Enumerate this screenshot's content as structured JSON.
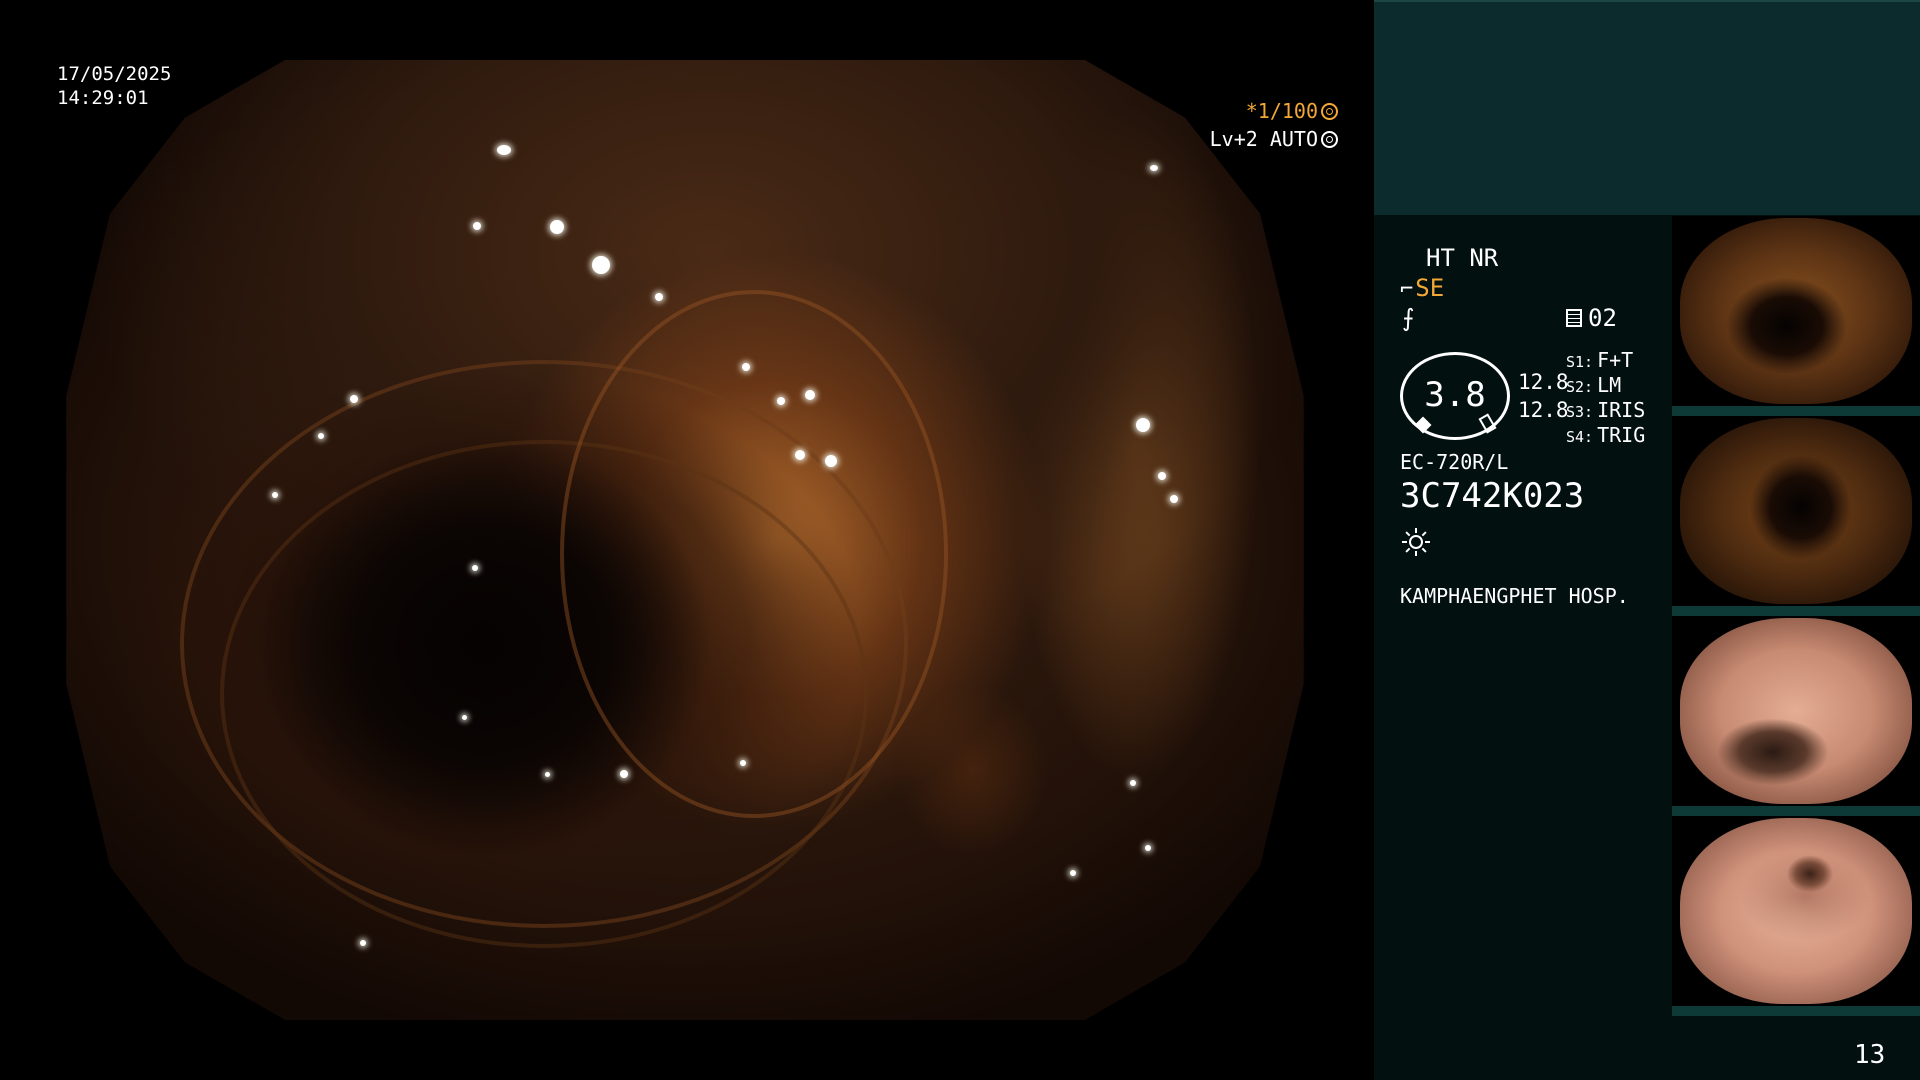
{
  "overlay": {
    "date": "17/05/2025",
    "time": "14:29:01",
    "shutter": "*1/100",
    "level": "Lv+2 AUTO"
  },
  "panel": {
    "ht_nr": "HT NR",
    "structure_enhance": "SE",
    "ne_sign": "⨍",
    "memo_count": "02",
    "zoom": "3.8",
    "value_1": "12.8",
    "value_2": "12.8",
    "scope_buttons": [
      {
        "key": "S1:",
        "label": "F+T"
      },
      {
        "key": "S2:",
        "label": "LM"
      },
      {
        "key": "S3:",
        "label": "IRIS"
      },
      {
        "key": "S4:",
        "label": "TRIG"
      }
    ],
    "model": "EC-720R/L",
    "serial": "3C742K023",
    "hospital": "KAMPHAENGPHET HOSP.",
    "page_number": "13"
  },
  "icons": {
    "shutter": "shutter-icon",
    "level": "iris-icon",
    "light": "light-source-icon",
    "memo": "memo-icon",
    "hand": "hand-icon"
  },
  "colors": {
    "accent_orange": "#f2a836",
    "panel_teal": "#0b2b2c",
    "panel_bg": "#031010"
  }
}
